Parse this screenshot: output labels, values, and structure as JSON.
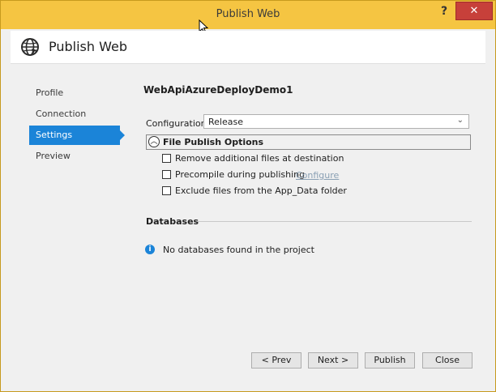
{
  "window": {
    "title": "Publish Web",
    "help_glyph": "?",
    "close_glyph": "✕"
  },
  "header": {
    "title": "Publish Web",
    "icon": "globe-icon"
  },
  "nav": {
    "items": [
      {
        "label": "Profile"
      },
      {
        "label": "Connection"
      },
      {
        "label": "Settings",
        "active": true
      },
      {
        "label": "Preview"
      }
    ]
  },
  "settings": {
    "project_name": "WebApiAzureDeployDemo1",
    "configuration_label": "Configuration:",
    "configuration_value": "Release",
    "file_publish_options_label": "File Publish Options",
    "options": [
      {
        "label": "Remove additional files at destination",
        "checked": false
      },
      {
        "label": "Precompile during publishing",
        "checked": false
      },
      {
        "label": "Exclude files from the App_Data folder",
        "checked": false
      }
    ],
    "configure_link": "Configure"
  },
  "databases": {
    "header": "Databases",
    "message": "No databases found in the project"
  },
  "buttons": {
    "prev": "< Prev",
    "next": "Next >",
    "publish": "Publish",
    "close": "Close"
  },
  "colors": {
    "titlebar": "#f5c542",
    "accent": "#1b84d8",
    "close_button": "#c7403a"
  }
}
